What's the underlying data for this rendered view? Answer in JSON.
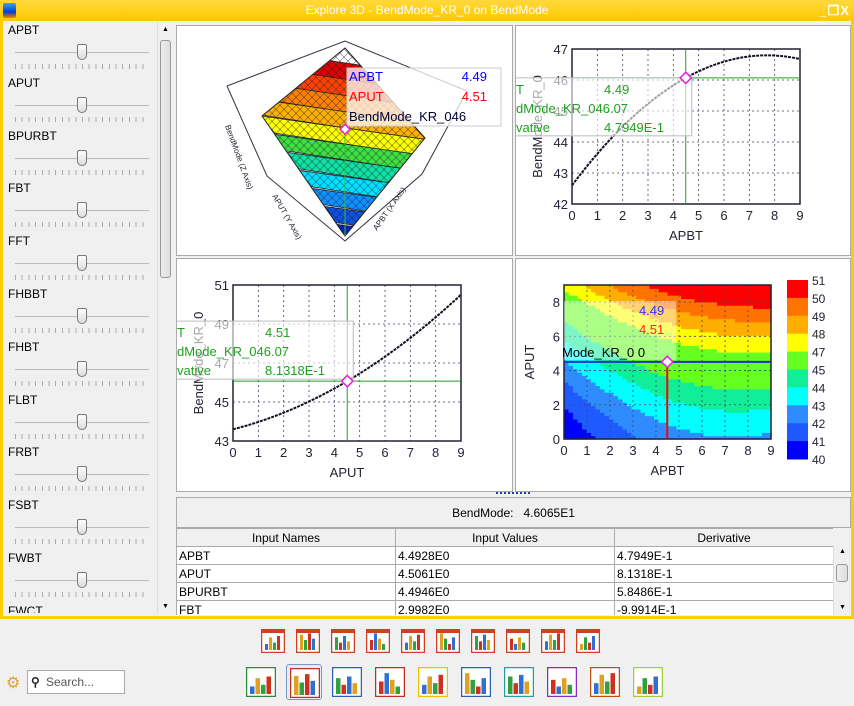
{
  "window": {
    "title": "Explore 3D - BendMode_KR_0 on BendMode",
    "controls": [
      "_",
      "❐",
      "X"
    ]
  },
  "sliders": [
    {
      "label": "APBT",
      "value_fraction": 0.5
    },
    {
      "label": "APUT",
      "value_fraction": 0.5
    },
    {
      "label": "BPURBT",
      "value_fraction": 0.5
    },
    {
      "label": "FBT",
      "value_fraction": 0.5
    },
    {
      "label": "FFT",
      "value_fraction": 0.5
    },
    {
      "label": "FHBBT",
      "value_fraction": 0.5
    },
    {
      "label": "FHBT",
      "value_fraction": 0.5
    },
    {
      "label": "FLBT",
      "value_fraction": 0.5
    },
    {
      "label": "FRBT",
      "value_fraction": 0.5
    },
    {
      "label": "FSBT",
      "value_fraction": 0.5
    },
    {
      "label": "FWBT",
      "value_fraction": 0.5
    },
    {
      "label": "FWCT",
      "value_fraction": 0.5
    }
  ],
  "chart_data": [
    {
      "type": "surface3d",
      "xlabel": "APBT (X Axis)",
      "ylabel": "APUT (Y Axis)",
      "zlabel": "BendMode (Z Axis)",
      "tooltip": [
        {
          "name": "APBT",
          "value": "4.49",
          "color": "#0000ff"
        },
        {
          "name": "APUT",
          "value": "4.51",
          "color": "#ff0000"
        },
        {
          "name": "BendMode_KR_046",
          "value": "",
          "color": "#000033"
        }
      ]
    },
    {
      "type": "line",
      "xlabel": "APBT",
      "ylabel": "BendMode_KR_0",
      "xlim": [
        0,
        9
      ],
      "ylim": [
        42,
        47
      ],
      "xticks": [
        0,
        1,
        2,
        3,
        4,
        5,
        6,
        7,
        8,
        9
      ],
      "yticks": [
        42,
        43,
        44,
        45,
        46,
        47
      ],
      "grid": true,
      "coef": [
        42.6,
        1.09,
        -0.0708
      ],
      "marker": {
        "x": 4.49,
        "y": 46.07
      },
      "tooltip": [
        {
          "name": "T",
          "value": "4.49"
        },
        {
          "name": "dMode_KR_046.07",
          "value": ""
        },
        {
          "name": "vative",
          "value": "4.7949E-1"
        }
      ]
    },
    {
      "type": "line",
      "xlabel": "APUT",
      "ylabel": "BendMode_KR_0",
      "xlim": [
        0,
        9
      ],
      "ylim": [
        43,
        51
      ],
      "xticks": [
        0,
        1,
        2,
        3,
        4,
        5,
        6,
        7,
        8,
        9
      ],
      "yticks": [
        43,
        45,
        47,
        49,
        51
      ],
      "grid": true,
      "coef": [
        43.6,
        0.328,
        0.0488
      ],
      "marker": {
        "x": 4.51,
        "y": 46.07
      },
      "tooltip": [
        {
          "name": "T",
          "value": "4.51"
        },
        {
          "name": "dMode_KR_046.07",
          "value": ""
        },
        {
          "name": "vative",
          "value": "8.1318E-1"
        }
      ]
    },
    {
      "type": "heatmap",
      "xlabel": "APBT",
      "ylabel": "APUT",
      "xlim": [
        0,
        9
      ],
      "ylim": [
        0,
        9
      ],
      "xticks": [
        0,
        1,
        2,
        3,
        4,
        5,
        6,
        7,
        8,
        9
      ],
      "yticks": [
        0,
        2,
        4,
        6,
        8
      ],
      "marker": {
        "x": 4.49,
        "y": 4.51
      },
      "colorbar": {
        "labels": [
          "51",
          "50",
          "49",
          "48",
          "47",
          "45",
          "44",
          "43",
          "42",
          "41",
          "40"
        ],
        "colors": [
          "#ff0000",
          "#ff7300",
          "#ffae00",
          "#ffff00",
          "#66ff22",
          "#11ee99",
          "#00ffff",
          "#2f8cff",
          "#1e5aff",
          "#0000ff"
        ]
      },
      "tooltip": [
        {
          "name": "",
          "value": "4.49",
          "color": "#3333ff"
        },
        {
          "name": "",
          "value": "4.51",
          "color": "#ff2222"
        },
        {
          "name": "Mode_KR_0 0",
          "value": "",
          "color": "#000"
        }
      ]
    }
  ],
  "summary": {
    "label": "BendMode:",
    "value": "4.6065E1"
  },
  "table": {
    "columns": [
      "Input Names",
      "Input Values",
      "Derivative"
    ],
    "rows": [
      [
        "APBT",
        "4.4928E0",
        "4.7949E-1"
      ],
      [
        "APUT",
        "4.5061E0",
        "8.1318E-1"
      ],
      [
        "BPURBT",
        "4.4946E0",
        "5.8486E-1"
      ],
      [
        "FBT",
        "2.9982E0",
        "-9.9914E-1"
      ],
      [
        "FFT",
        "",
        ""
      ]
    ]
  },
  "toolbar": {
    "row1": [
      {
        "icon": "heatmap-grid-icon",
        "color": "#d04020"
      },
      {
        "icon": "bar-scatter-matrix-icon",
        "color": "#d04020"
      },
      {
        "icon": "boxplot-icon",
        "color": "#d04020"
      },
      {
        "icon": "multi-boxplot-icon",
        "color": "#d04020"
      },
      {
        "icon": "parallel-lines-icon",
        "color": "#d04020"
      },
      {
        "icon": "boxplot-2-icon",
        "color": "#d04020"
      },
      {
        "icon": "network-icon",
        "color": "#d04020"
      },
      {
        "icon": "bar-chart-icon",
        "color": "#d04020"
      },
      {
        "icon": "pie-grid-icon",
        "color": "#d04020"
      },
      {
        "icon": "bar-3d-icon",
        "color": "#d04020"
      }
    ],
    "row2": [
      {
        "icon": "band-chart-icon",
        "color": "#2a8a3a"
      },
      {
        "icon": "stacked-bar-icon",
        "color": "#c03020",
        "selected": true
      },
      {
        "icon": "distribution-icon",
        "color": "#3060b0"
      },
      {
        "icon": "funnel-icon",
        "color": "#c03020"
      },
      {
        "icon": "area-chart-icon",
        "color": "#f0c000"
      },
      {
        "icon": "column-chart-icon",
        "color": "#3060b0"
      },
      {
        "icon": "bubble-cluster-icon",
        "color": "#20a0a0"
      },
      {
        "icon": "surface-icon",
        "color": "#8030c0"
      },
      {
        "icon": "split-arrows-icon",
        "color": "#c05010"
      },
      {
        "icon": "scatter-line-icon",
        "color": "#a0d040"
      }
    ],
    "search_placeholder": "Search..."
  }
}
